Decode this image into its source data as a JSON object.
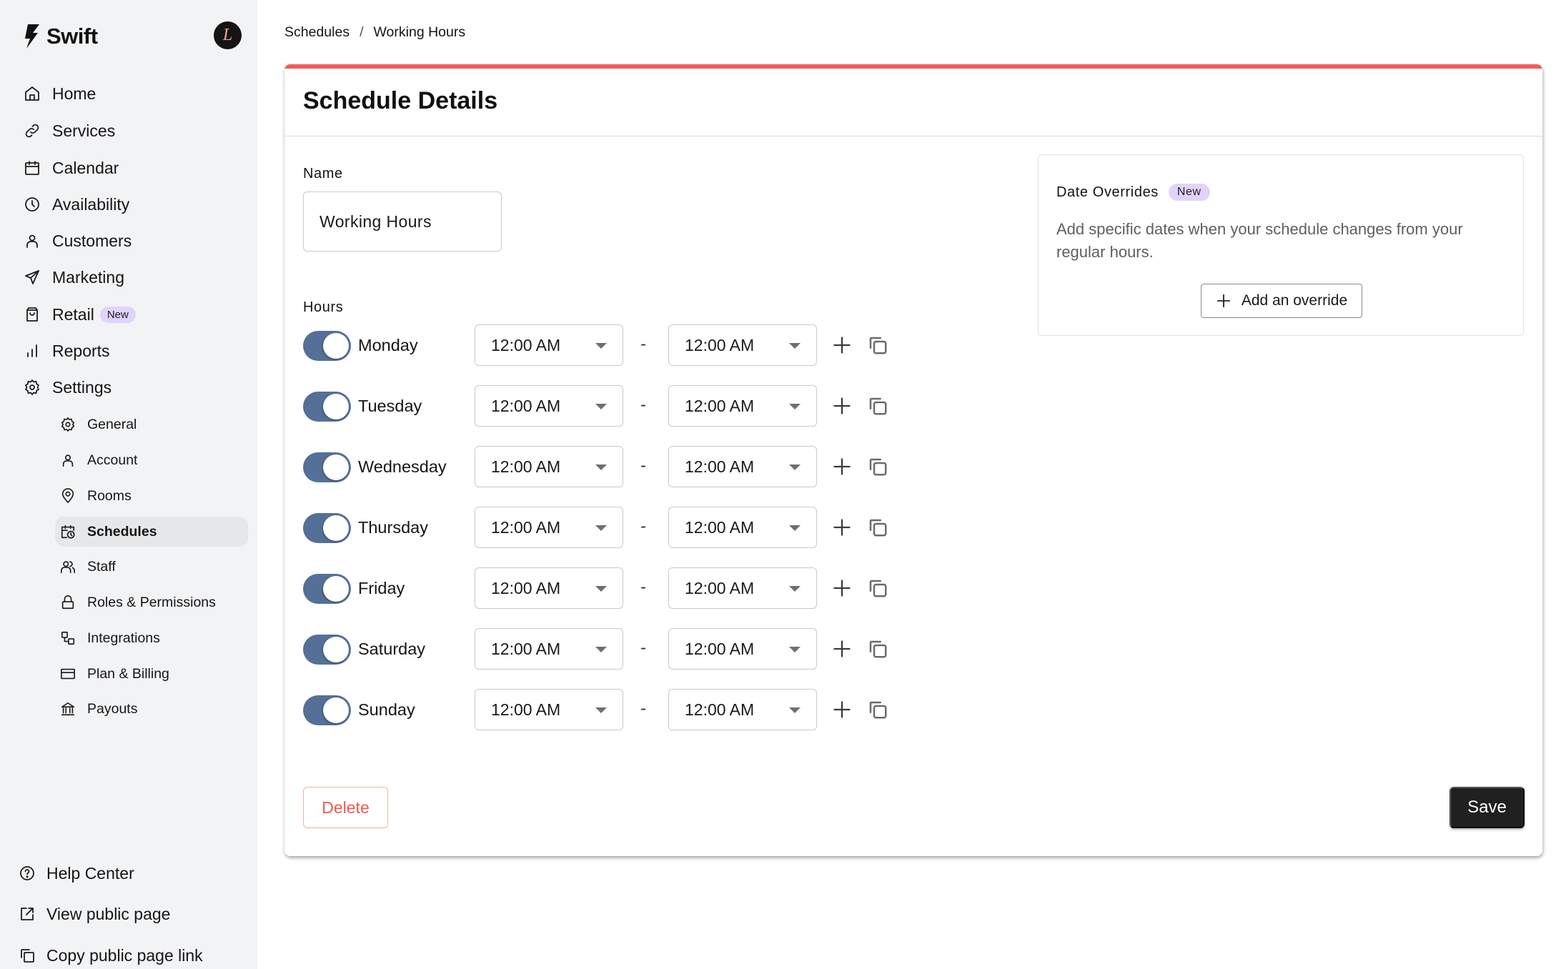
{
  "app": {
    "name": "Swift",
    "avatar_initial": "L"
  },
  "sidebar": {
    "nav": [
      {
        "label": "Home",
        "icon": "home-icon"
      },
      {
        "label": "Services",
        "icon": "link-icon"
      },
      {
        "label": "Calendar",
        "icon": "calendar-icon"
      },
      {
        "label": "Availability",
        "icon": "clock-icon"
      },
      {
        "label": "Customers",
        "icon": "user-icon"
      },
      {
        "label": "Marketing",
        "icon": "send-icon"
      },
      {
        "label": "Retail",
        "icon": "shopping-bag-icon",
        "badge": "New"
      },
      {
        "label": "Reports",
        "icon": "bar-chart-icon"
      },
      {
        "label": "Settings",
        "icon": "gear-icon"
      }
    ],
    "settings_items": [
      {
        "label": "General",
        "icon": "gear-icon"
      },
      {
        "label": "Account",
        "icon": "user-icon"
      },
      {
        "label": "Rooms",
        "icon": "map-pin-icon"
      },
      {
        "label": "Schedules",
        "icon": "calendar-clock-icon",
        "active": true
      },
      {
        "label": "Staff",
        "icon": "users-icon"
      },
      {
        "label": "Roles & Permissions",
        "icon": "lock-icon"
      },
      {
        "label": "Integrations",
        "icon": "integrations-icon"
      },
      {
        "label": "Plan & Billing",
        "icon": "credit-card-icon"
      },
      {
        "label": "Payouts",
        "icon": "bank-icon"
      }
    ],
    "footer": [
      {
        "label": "Help Center",
        "icon": "help-circle-icon"
      },
      {
        "label": "View public page",
        "icon": "external-link-icon"
      },
      {
        "label": "Copy public page link",
        "icon": "copy-icon"
      }
    ]
  },
  "breadcrumb": {
    "parent": "Schedules",
    "separator": "/",
    "current": "Working Hours"
  },
  "card": {
    "title": "Schedule Details",
    "accent_color": "#f25c54",
    "name_label": "Name",
    "name_value": "Working Hours",
    "hours_label": "Hours",
    "days": [
      {
        "day": "Monday",
        "enabled": true,
        "start": "12:00 AM",
        "end": "12:00 AM"
      },
      {
        "day": "Tuesday",
        "enabled": true,
        "start": "12:00 AM",
        "end": "12:00 AM"
      },
      {
        "day": "Wednesday",
        "enabled": true,
        "start": "12:00 AM",
        "end": "12:00 AM"
      },
      {
        "day": "Thursday",
        "enabled": true,
        "start": "12:00 AM",
        "end": "12:00 AM"
      },
      {
        "day": "Friday",
        "enabled": true,
        "start": "12:00 AM",
        "end": "12:00 AM"
      },
      {
        "day": "Saturday",
        "enabled": true,
        "start": "12:00 AM",
        "end": "12:00 AM"
      },
      {
        "day": "Sunday",
        "enabled": true,
        "start": "12:00 AM",
        "end": "12:00 AM"
      }
    ],
    "range_separator": "-",
    "overrides": {
      "title": "Date Overrides",
      "badge": "New",
      "description": "Add specific dates when your schedule changes from your regular hours.",
      "button_label": "Add an override"
    },
    "delete_label": "Delete",
    "save_label": "Save"
  },
  "colors": {
    "toggle_on": "#557098",
    "badge_bg": "#e2d3fb",
    "danger": "#ef5b4e",
    "primary_button": "#202020"
  }
}
